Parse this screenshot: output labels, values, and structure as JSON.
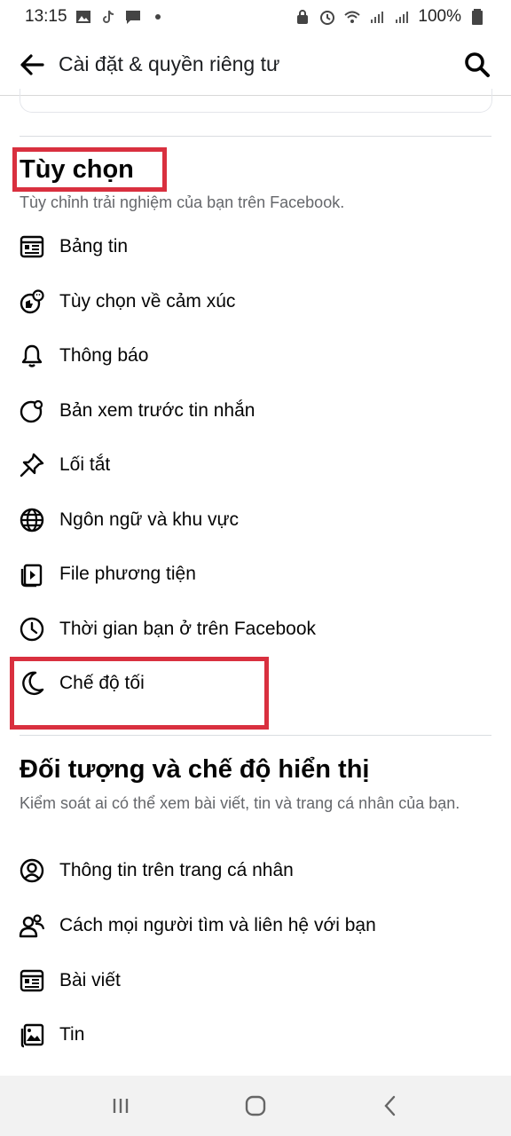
{
  "status_bar": {
    "time": "13:15",
    "battery": "100%"
  },
  "header": {
    "title": "Cài đặt & quyền riêng tư"
  },
  "preferences": {
    "title": "Tùy chọn",
    "description": "Tùy chỉnh trải nghiệm của bạn trên Facebook.",
    "items": [
      {
        "label": "Bảng tin",
        "icon": "news-feed-icon"
      },
      {
        "label": "Tùy chọn về cảm xúc",
        "icon": "reaction-icon"
      },
      {
        "label": "Thông báo",
        "icon": "bell-icon"
      },
      {
        "label": "Bản xem trước tin nhắn",
        "icon": "message-preview-icon"
      },
      {
        "label": "Lối tắt",
        "icon": "pin-icon"
      },
      {
        "label": "Ngôn ngữ và khu vực",
        "icon": "globe-icon"
      },
      {
        "label": "File phương tiện",
        "icon": "media-icon"
      },
      {
        "label": "Thời gian bạn ở trên Facebook",
        "icon": "clock-icon"
      },
      {
        "label": "Chế độ tối",
        "icon": "moon-icon"
      }
    ]
  },
  "audience": {
    "title": "Đối tượng và chế độ hiển thị",
    "description": "Kiểm soát ai có thể xem bài viết, tin và trang cá nhân của bạn.",
    "items": [
      {
        "label": "Thông tin trên trang cá nhân",
        "icon": "profile-icon"
      },
      {
        "label": "Cách mọi người tìm và liên hệ với bạn",
        "icon": "people-icon"
      },
      {
        "label": "Bài viết",
        "icon": "posts-icon"
      },
      {
        "label": "Tin",
        "icon": "stories-icon"
      }
    ]
  },
  "colors": {
    "highlight": "#d9303f",
    "text_primary": "#050505",
    "text_secondary": "#65676b"
  }
}
